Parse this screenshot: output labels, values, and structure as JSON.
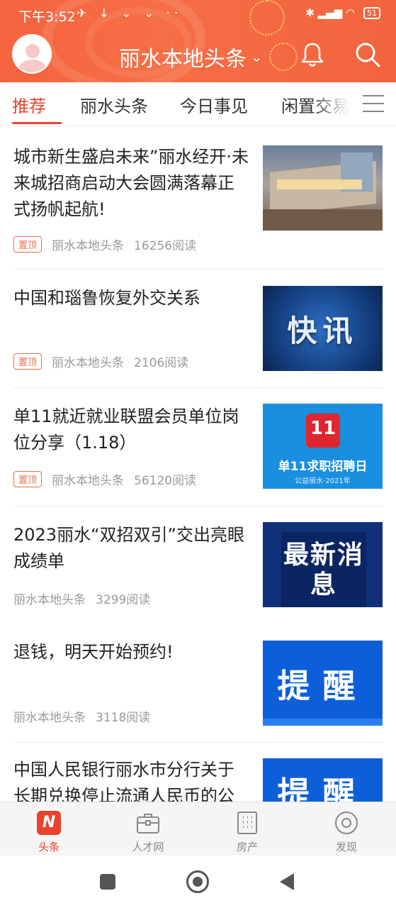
{
  "status_bar": {
    "time": "下午3:52",
    "notifications": "✈ ↓ ⌄ ⌄ ··",
    "signal": "✱ ▂▄▆ ◠",
    "battery": "51"
  },
  "header": {
    "title": "丽水本地头条",
    "chevron": "⌄"
  },
  "tabs": [
    {
      "label": "推荐"
    },
    {
      "label": "丽水头条"
    },
    {
      "label": "今日事见"
    },
    {
      "label": "闲置交易"
    }
  ],
  "feed": [
    {
      "title": "城市新生盛启未来”丽水经开·未来城招商启动大会圆满落幕正式扬帆起航!",
      "pinned": "置顶",
      "source": "丽水本地头条",
      "reads": "16256阅读"
    },
    {
      "title": "中国和瑙鲁恢复外交关系",
      "pinned": "置顶",
      "source": "丽水本地头条",
      "reads": "2106阅读",
      "thumb_text": "快讯"
    },
    {
      "title": "单11就近就业联盟会员单位岗位分享（1.18）",
      "pinned": "置顶",
      "source": "丽水本地头条",
      "reads": "56120阅读",
      "thumb_logo": "11",
      "thumb_text": "单11求职招聘日",
      "thumb_sub": "公益丽水·2021年"
    },
    {
      "title": "2023丽水“双招双引”交出亮眼成绩单",
      "source": "丽水本地头条",
      "reads": "3299阅读",
      "thumb_text": "最新消息"
    },
    {
      "title": "退钱，明天开始预约!",
      "source": "丽水本地头条",
      "reads": "3118阅读",
      "thumb_text": "提醒"
    },
    {
      "title": "中国人民银行丽水市分行关于长期兑换停止流通人民币的公",
      "thumb_text": "提醒"
    }
  ],
  "bottom_nav": [
    {
      "label": "头条",
      "icon": "N"
    },
    {
      "label": "人才网"
    },
    {
      "label": "房产"
    },
    {
      "label": "发现"
    }
  ],
  "colors": {
    "accent": "#e8432f",
    "header_bg": "#f5643e",
    "pin_border": "#e8704a"
  }
}
